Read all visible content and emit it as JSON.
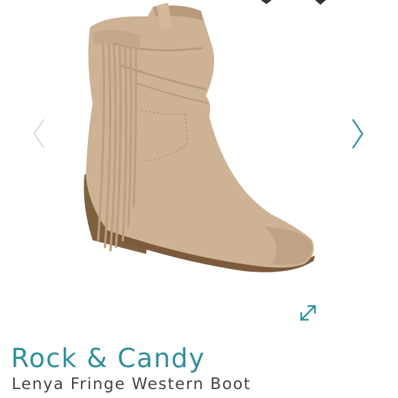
{
  "product": {
    "brand": "Rock & Candy",
    "name": "Lenya Fringe Western Boot"
  },
  "carousel": {
    "prev_icon": "chevron-left-icon",
    "next_icon": "chevron-right-icon",
    "expand_icon": "expand-icon"
  },
  "colors": {
    "brand": "#2f8f9c",
    "arrow_next": "#2f8f9c",
    "arrow_prev": "#d4d9dc",
    "boot": "#cdb293",
    "sole": "#7d5a3c"
  }
}
